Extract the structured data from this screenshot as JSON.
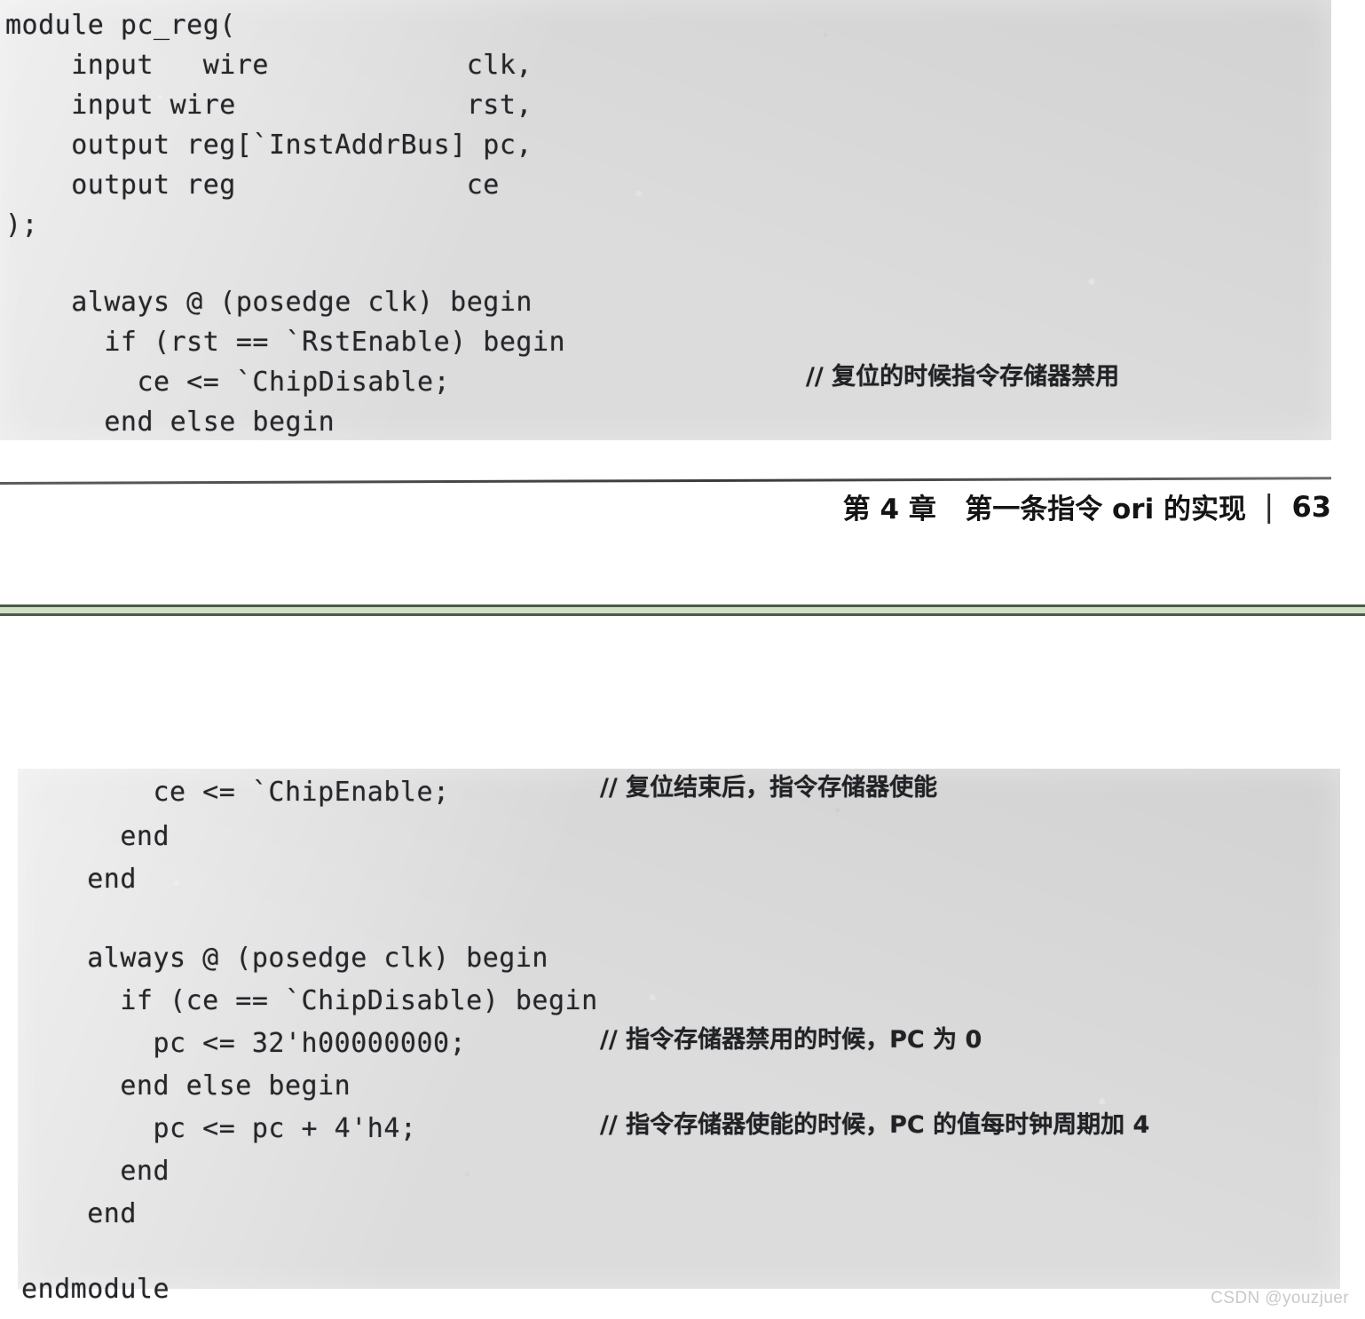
{
  "document": {
    "kind": "scanned-book-page",
    "watermark": "CSDN @youzjuer"
  },
  "page_top": {
    "code_block": {
      "lines": [
        {
          "code": "module pc_reg(",
          "indent": 0
        },
        {
          "code": "    input   wire            clk,",
          "indent": 0
        },
        {
          "code": "    input wire              rst,",
          "indent": 0
        },
        {
          "code": "    output reg[`InstAddrBus] pc,",
          "indent": 0
        },
        {
          "code": "    output reg              ce",
          "indent": 0
        },
        {
          "code": ");",
          "indent": 0
        },
        {
          "code": "",
          "indent": 0
        },
        {
          "code": "    always @ (posedge clk) begin",
          "indent": 0
        },
        {
          "code": "      if (rst == `RstEnable) begin",
          "indent": 0
        },
        {
          "code": "        ce <= `ChipDisable;",
          "indent": 0,
          "comment": "// 复位的时候指令存储器禁用"
        },
        {
          "code": "      end else begin",
          "indent": 0
        }
      ]
    },
    "footer": {
      "chapter": "第 4 章   第一条指令 ori 的实现",
      "separator": "|",
      "page_number": "63"
    }
  },
  "page_bottom": {
    "code_block": {
      "lines": [
        {
          "code": "        ce <= `ChipEnable;",
          "comment": "// 复位结束后，指令存储器使能"
        },
        {
          "code": "      end",
          "comment": ""
        },
        {
          "code": "    end",
          "comment": ""
        },
        {
          "code": "",
          "comment": ""
        },
        {
          "code": "    always @ (posedge clk) begin",
          "comment": ""
        },
        {
          "code": "      if (ce == `ChipDisable) begin",
          "comment": ""
        },
        {
          "code": "        pc <= 32'h00000000;",
          "comment": "// 指令存储器禁用的时候，PC 为 0"
        },
        {
          "code": "      end else begin",
          "comment": ""
        },
        {
          "code": "        pc <= pc + 4'h4;",
          "comment": "// 指令存储器使能的时候，PC 的值每时钟周期加 4"
        },
        {
          "code": "      end",
          "comment": ""
        },
        {
          "code": "    end",
          "comment": ""
        },
        {
          "code": "",
          "comment": ""
        },
        {
          "code": "endmodule",
          "comment": ""
        }
      ]
    }
  },
  "colors": {
    "paper": "#ffffff",
    "code_paper": "#dcdcdc",
    "ink": "#24262a",
    "separator_fill": "#cfdfc4",
    "separator_border": "#4b5a49",
    "watermark": "#c9c9c9"
  }
}
